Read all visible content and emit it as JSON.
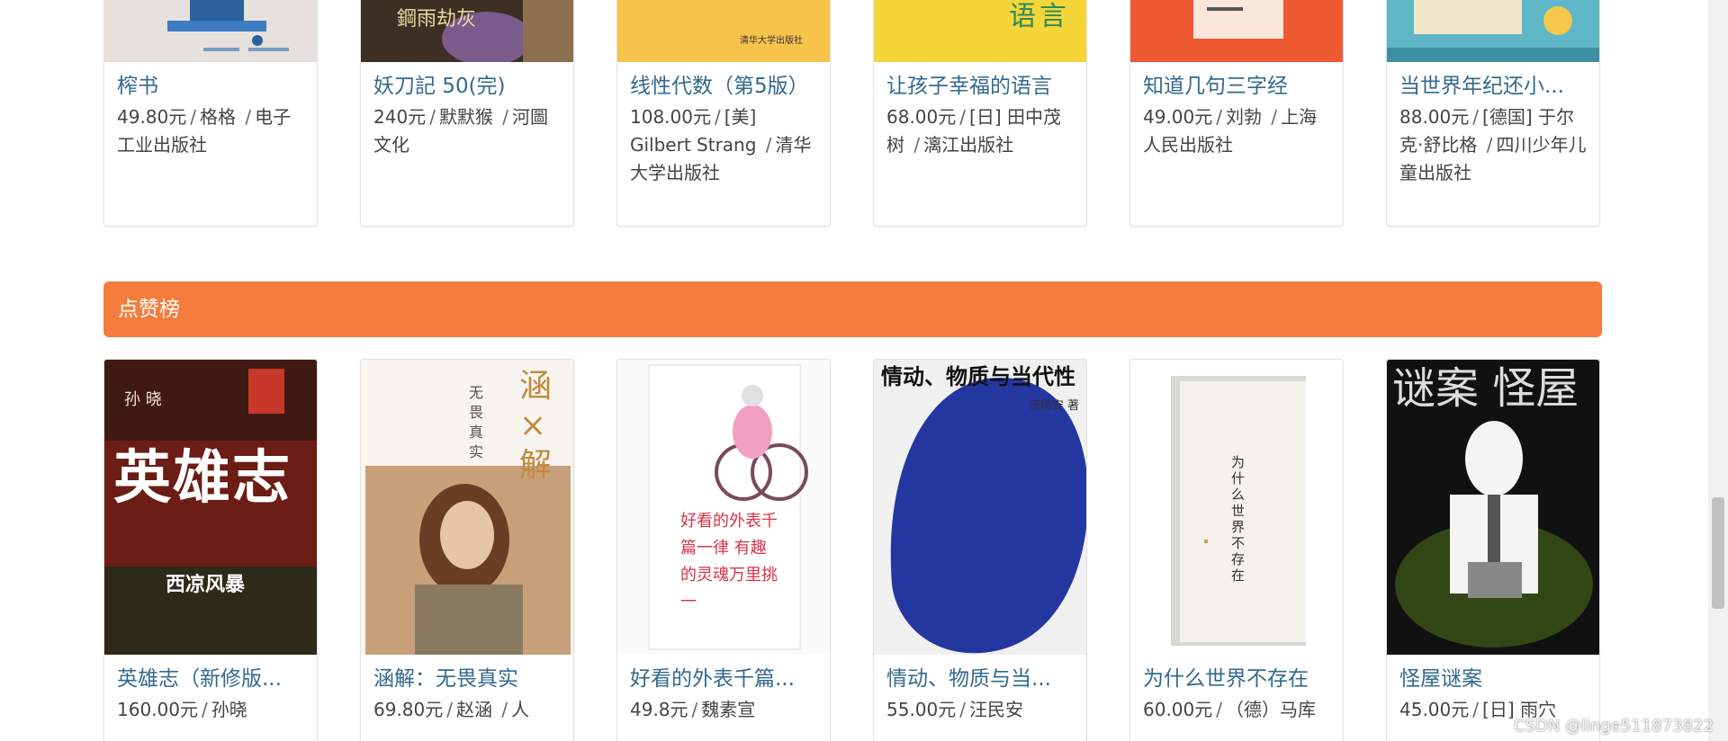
{
  "top_books": [
    {
      "title": "榨书",
      "price": "49.80元",
      "author": "格格",
      "publisher": "电子工业出版社",
      "cover_color": "#e6e1dc"
    },
    {
      "title": "妖刀記 50(完)",
      "price": "240元",
      "author": "默默猴",
      "publisher": "河圖文化",
      "cover_color": "#4a3a2c"
    },
    {
      "title": "线性代数（第5版）",
      "price": "108.00元",
      "author": "[美] Gilbert Strang",
      "publisher": "清华大学出版社",
      "cover_color": "#f7c34b",
      "cover_text": "清华大学出版社"
    },
    {
      "title": "让孩子幸福的语言",
      "price": "68.00元",
      "author": "[日] 田中茂树",
      "publisher": "漓江出版社",
      "cover_color": "#f5d638",
      "cover_text": "语言"
    },
    {
      "title": "知道几句三字经",
      "price": "49.00元",
      "author": "刘勃",
      "publisher": "上海人民出版社",
      "cover_color": "#ef5a33"
    },
    {
      "title": "当世界年纪还小...",
      "price": "88.00元",
      "author": "[德国] 于尔克·舒比格",
      "publisher": "四川少年儿童出版社",
      "cover_color": "#5fb6c7"
    }
  ],
  "section": {
    "title": "点赞榜"
  },
  "like_books": [
    {
      "title": "英雄志（新修版...",
      "price": "160.00元",
      "author": "孙晓",
      "cover_color": "#7a1f1a",
      "cover_text": "英雄志",
      "cover_sub": "西凉风暴",
      "cover_author": "孙 晓"
    },
    {
      "title": "涵解：无畏真实",
      "price": "69.80元",
      "author": "赵涵",
      "publisher": "人",
      "cover_color": "#f8f4ef",
      "cover_text": "涵×解",
      "cover_sub": "无畏真实"
    },
    {
      "title": "好看的外表千篇...",
      "price": "49.8元",
      "author": "魏素宣",
      "cover_color": "#fbfbfb",
      "cover_text": "好看的外表千篇一律 有趣的灵魂万里挑一"
    },
    {
      "title": "情动、物质与当...",
      "price": "55.00元",
      "author": "汪民安",
      "cover_color": "#2a3a9a",
      "cover_text": "情动、物质与当代性",
      "cover_author": "汪民安 著"
    },
    {
      "title": "为什么世界不存在",
      "price": "60.00元",
      "author": "（德）马库",
      "cover_color": "#f2f2ee",
      "cover_text": "为什么世界不存在"
    },
    {
      "title": "怪屋谜案",
      "price": "45.00元",
      "author": "[日] 雨穴",
      "cover_color": "#111111",
      "cover_text": "谜案 怪屋"
    }
  ],
  "watermark": "CSDN @linge511873822"
}
